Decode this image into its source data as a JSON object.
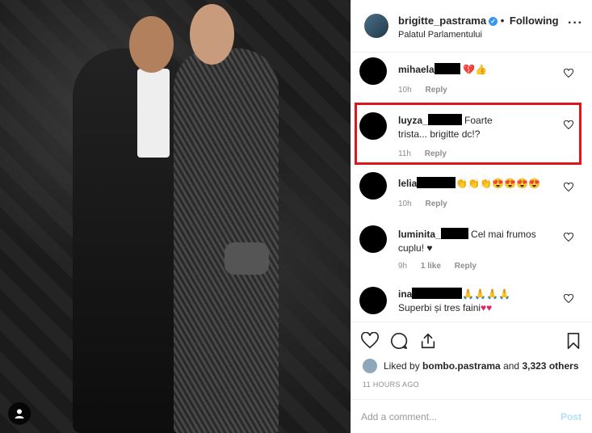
{
  "header": {
    "username": "brigitte_pastrama",
    "follow_status": "Following",
    "separator": "•",
    "location": "Palatul Parlamentului",
    "more_icon": "more-options-icon"
  },
  "comments": [
    {
      "user": "mihaela",
      "text": "",
      "emoji": "💔👍",
      "time": "10h",
      "likes": "",
      "reply": "Reply"
    },
    {
      "user": "luyza_",
      "text": "Foarte trista... brigitte dc!?",
      "emoji": "",
      "time": "11h",
      "likes": "",
      "reply": "Reply"
    },
    {
      "user": "lelia",
      "text": "",
      "emoji": "👏👏👏😍😍😍😍",
      "time": "10h",
      "likes": "",
      "reply": "Reply"
    },
    {
      "user": "luminita_",
      "text": "Cel mai frumos cuplu! ♥",
      "emoji": "",
      "time": "9h",
      "likes": "1 like",
      "reply": "Reply"
    },
    {
      "user": "ina",
      "text": "Superbi și tres faini",
      "emoji": "🙏🙏🙏🙏",
      "emoji2": "♥♥",
      "time": "",
      "likes": "",
      "reply": ""
    }
  ],
  "actions": {
    "like_icon": "heart-icon",
    "comment_icon": "comment-icon",
    "share_icon": "share-icon",
    "save_icon": "bookmark-icon"
  },
  "likes": {
    "prefix": "Liked by",
    "user": "bombo.pastrama",
    "middle": "and",
    "count": "3,323 others"
  },
  "timestamp": "11 HOURS AGO",
  "add_comment": {
    "placeholder": "Add a comment...",
    "post_label": "Post"
  },
  "colors": {
    "highlight": "#e0151b",
    "verified": "#3897f0",
    "post_disabled": "#b2dffc"
  }
}
